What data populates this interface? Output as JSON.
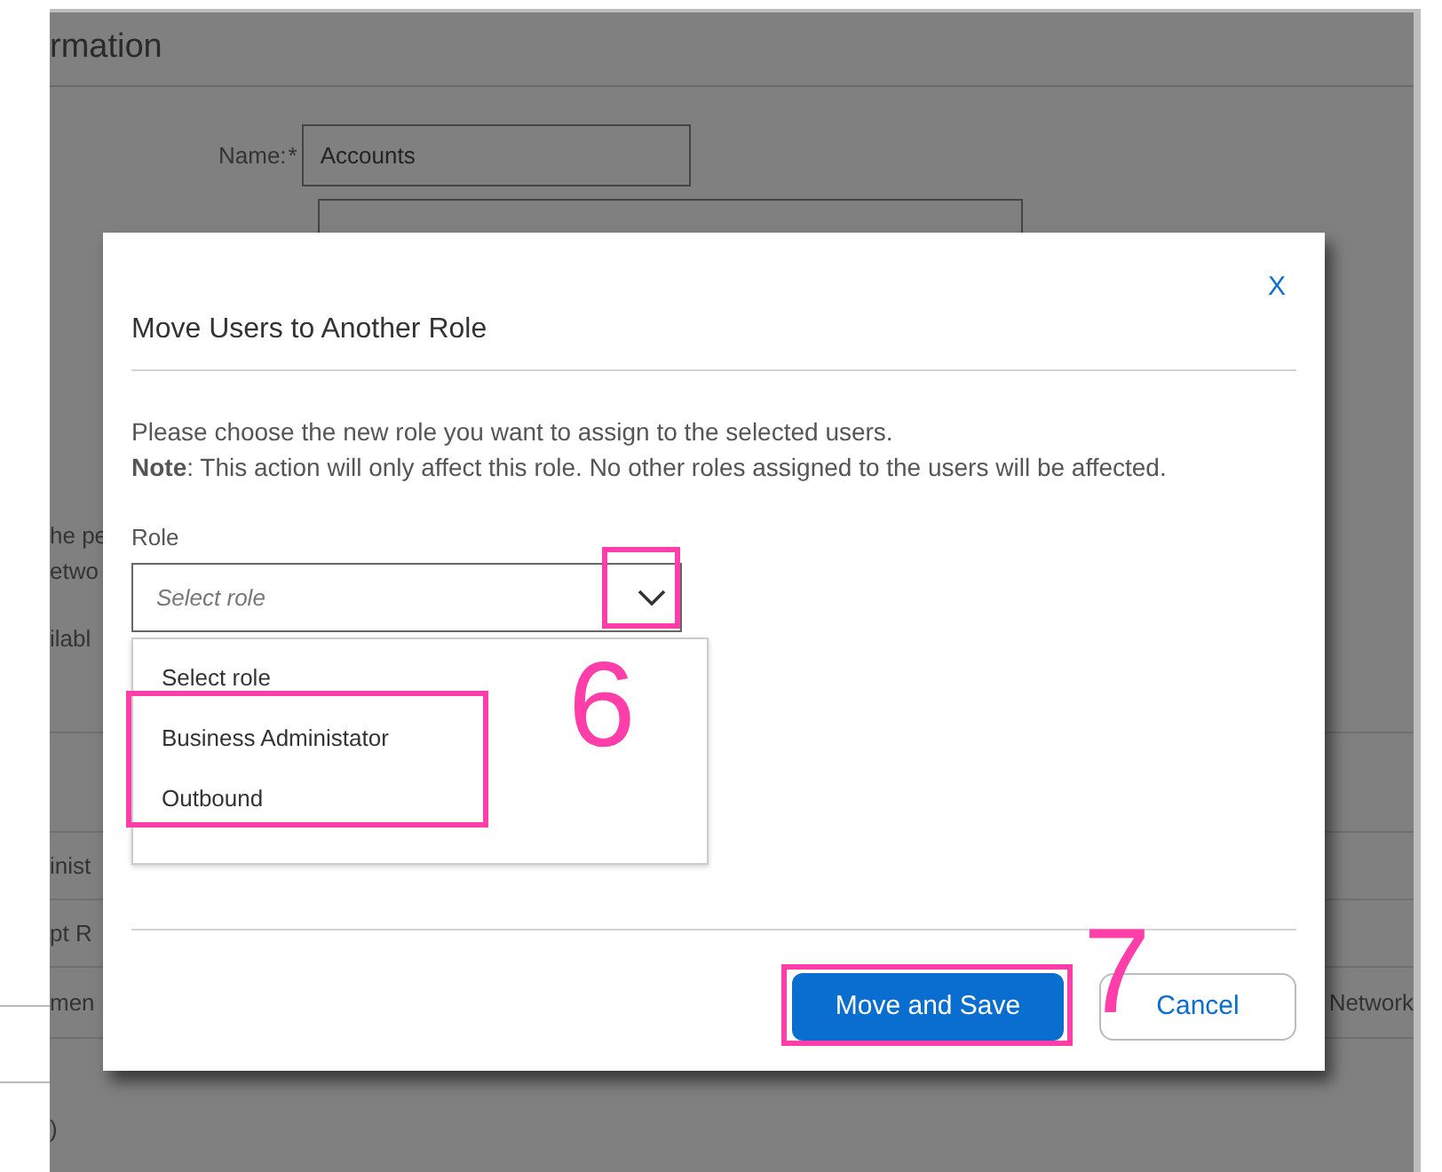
{
  "background_page": {
    "section_title": "rmation",
    "name_label": "Name:",
    "required_mark": "*",
    "name_value": "Accounts",
    "fragments": [
      "he pe",
      "etwo",
      "ilabl",
      "inist",
      "pt R",
      "men",
      ")"
    ],
    "right_fragment": "Network"
  },
  "dialog": {
    "close": "X",
    "title": "Move Users to Another Role",
    "message": "Please choose the new role you want to assign to the selected users.",
    "note": "**Note**: This action will only affect this role. No other roles assigned to the users will be affected.",
    "field_label": "Role",
    "select": {
      "placeholder": "Select role",
      "expanded": true,
      "options": [
        "Select role",
        "Business Administator",
        "Outbound"
      ]
    },
    "buttons": [
      {
        "label": "Move and Save",
        "kind": "primary"
      },
      {
        "label": "Cancel",
        "kind": "secondary"
      }
    ]
  },
  "annotations": [
    {
      "number": "6"
    },
    {
      "number": "7"
    }
  ]
}
